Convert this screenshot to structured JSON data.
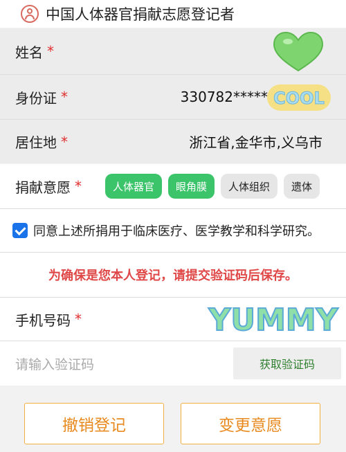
{
  "header": {
    "title": "中国人体器官捐献志愿登记者"
  },
  "form": {
    "name": {
      "label": "姓名",
      "required_mark": "*"
    },
    "id": {
      "label": "身份证",
      "required_mark": "*",
      "value": "330782*****"
    },
    "address": {
      "label": "居住地",
      "required_mark": "*",
      "value": "浙江省,金华市,义乌市"
    },
    "donation": {
      "label": "捐献意愿",
      "required_mark": "*",
      "options": [
        {
          "label": "人体器官",
          "selected": true
        },
        {
          "label": "眼角膜",
          "selected": true
        },
        {
          "label": "人体组织",
          "selected": false
        },
        {
          "label": "遗体",
          "selected": false
        }
      ]
    },
    "consent": {
      "checked": true,
      "text": "同意上述所捐用于临床医疗、医学教学和科学研究。"
    },
    "notice": "为确保是您本人登记，请提交验证码后保存。",
    "phone": {
      "label": "手机号码",
      "required_mark": "*"
    },
    "code": {
      "placeholder": "请输入验证码",
      "button": "获取验证码"
    }
  },
  "actions": {
    "cancel": "撤销登记",
    "change": "变更意愿"
  },
  "stickers": {
    "cool_text": "COOL",
    "yummy_text": "YUMMY"
  },
  "colors": {
    "accent_green": "#3cc46a",
    "required_red": "#e03030",
    "notice_red": "#e04848",
    "button_orange": "#e88a1f",
    "checkbox_blue": "#1a73e8"
  }
}
